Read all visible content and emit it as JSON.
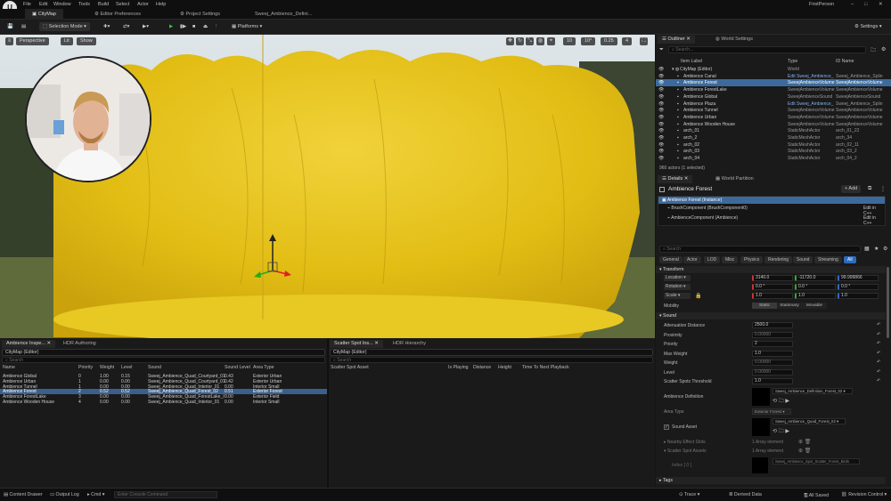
{
  "menu": [
    "File",
    "Edit",
    "Window",
    "Tools",
    "Build",
    "Select",
    "Actor",
    "Help"
  ],
  "project_name": "FirstPerson",
  "tabs": [
    "CityMap",
    "Editor Preferences",
    "Project Settings",
    "Sweej_Ambience_Defini..."
  ],
  "toolbar": {
    "selection_mode": "Selection Mode",
    "platforms": "Platforms",
    "settings": "Settings"
  },
  "viewport": {
    "perspective": "Perspective",
    "lit": "Lit",
    "show": "Show",
    "snap_values": [
      "10",
      "10°",
      "0.25",
      "4"
    ]
  },
  "bottom_left": {
    "tabs": [
      "Ambience Inspe...",
      "HDR Authoring"
    ],
    "world_dropdown": "CityMap (Editor)",
    "search_placeholder": "Search",
    "columns": [
      "Name",
      "Priority",
      "Weight",
      "Level",
      "Sound",
      "Sound Level",
      "Area Type"
    ],
    "rows": [
      [
        "Ambience Global",
        "0",
        "1.00",
        "0.15",
        "Sweej_Ambience_Quad_Courtyard_01",
        "0.43",
        "Exterior Urban"
      ],
      [
        "Ambience Urban",
        "1",
        "0.00",
        "0.00",
        "Sweej_Ambience_Quad_Courtyard_01",
        "0.42",
        "Exterior Urban"
      ],
      [
        "Ambience Tunnel",
        "1",
        "0.00",
        "0.00",
        "Sweej_Ambience_Quad_Interior_01",
        "0.00",
        "Interior Small"
      ],
      [
        "Ambience Forest",
        "2",
        "0.52",
        "0.52",
        "Sweej_Ambience_Quad_Forest_02",
        "0.51",
        "Exterior Forest"
      ],
      [
        "Ambience ForestLake",
        "3",
        "0.00",
        "0.00",
        "Sweej_Ambience_Quad_ForestLake_I",
        "0.00",
        "Exterior Field"
      ],
      [
        "Ambience Wooden House",
        "4",
        "0.00",
        "0.00",
        "Sweej_Ambience_Quad_Interior_01",
        "0.00",
        "Interior Small"
      ]
    ],
    "selected_row": 3
  },
  "bottom_right": {
    "tabs": [
      "Scatter Spot Ins...",
      "HDR Hierarchy"
    ],
    "world_dropdown": "CityMap (Editor)",
    "search_placeholder": "Search",
    "columns": [
      "Scatter Spot Asset",
      "Is Playing",
      "Distance",
      "Height",
      "Time To Next Playback"
    ]
  },
  "outliner": {
    "tabs": [
      "Outliner",
      "World Settings"
    ],
    "search_placeholder": "Search...",
    "columns": [
      "Item Label",
      "Type",
      "ID Name"
    ],
    "rows": [
      [
        "CityMap (Editor)",
        "World",
        ""
      ],
      [
        "Ambience Canal",
        "Edit Sweej_Ambience_",
        "Sweej_Ambience_Splin"
      ],
      [
        "Ambience Forest",
        "SweejAmbienceVolume",
        "SweejAmbienceVolume"
      ],
      [
        "Ambience ForestLake",
        "SweejAmbienceVolume",
        "SweejAmbienceVolume"
      ],
      [
        "Ambience Global",
        "SweejAmbienceSound",
        "SweejAmbienceSound"
      ],
      [
        "Ambience Plaza",
        "Edit Sweej_Ambience_",
        "Sweej_Ambience_Splin"
      ],
      [
        "Ambience Tunnel",
        "SweejAmbienceVolume",
        "SweejAmbienceVolume"
      ],
      [
        "Ambience Urban",
        "SweejAmbienceVolume",
        "SweejAmbienceVolume"
      ],
      [
        "Ambience Wooden House",
        "SweejAmbienceVolume",
        "SweejAmbienceVolume"
      ],
      [
        "arch_01",
        "StaticMeshActor",
        "arch_01_22"
      ],
      [
        "arch_2",
        "StaticMeshActor",
        "arch_34"
      ],
      [
        "arch_02",
        "StaticMeshActor",
        "arch_02_11"
      ],
      [
        "arch_03",
        "StaticMeshActor",
        "arch_03_2"
      ],
      [
        "arch_04",
        "StaticMeshActor",
        "arch_04_2"
      ]
    ],
    "selected_row": 2,
    "footer": "960 actors (1 selected)"
  },
  "details": {
    "tabs": [
      "Details",
      "World Partition"
    ],
    "title": "Ambience Forest",
    "add_label": "+ Add",
    "instance_label": "Ambience Forest (Instance)",
    "components": [
      {
        "name": "BrushComponent (BrushComponent0)",
        "action": "Edit in C++"
      },
      {
        "name": "AmbienceComponent (Ambience)",
        "action": "Edit in C++"
      }
    ],
    "search_placeholder": "Search",
    "filter_tabs": [
      "General",
      "Actor",
      "LOD",
      "Misc",
      "Physics",
      "Rendering",
      "Sound",
      "Streaming",
      "All"
    ],
    "transform_header": "Transform",
    "location": {
      "label": "Location",
      "x": "3140.0",
      "y": "-11720.0",
      "z": "99.999866"
    },
    "rotation": {
      "label": "Rotation",
      "x": "0.0 °",
      "y": "0.0 °",
      "z": "0.0 °"
    },
    "scale": {
      "label": "Scale",
      "x": "1.0",
      "y": "1.0",
      "z": "1.0"
    },
    "mobility": {
      "label": "Mobility",
      "options": [
        "Static",
        "Stationary",
        "Movable"
      ]
    },
    "sound_header": "Sound",
    "sound_props": [
      {
        "label": "Attenuation Distance",
        "value": "2500.0"
      },
      {
        "label": "Proximity",
        "value": "0.00000"
      },
      {
        "label": "Priority",
        "value": "2"
      },
      {
        "label": "Max Weight",
        "value": "1.0"
      },
      {
        "label": "Weight",
        "value": "0.00000"
      },
      {
        "label": "Level",
        "value": "0.00000"
      },
      {
        "label": "Scatter Spots Threshold",
        "value": "1.0"
      }
    ],
    "ambience_definition": {
      "label": "Ambience Definition",
      "value": "Sweej_Ambience_Definition_Forest_02"
    },
    "area_type": {
      "label": "Area Type",
      "value": "Exterior Forest"
    },
    "sound_asset": {
      "label": "Sound Asset",
      "value": "Sweej_Ambience_Quad_Forest_02"
    },
    "nearby_effect": {
      "label": "Nearby Effect Slots",
      "value": "1 Array element"
    },
    "scatter_spot_assets": {
      "label": "Scatter Spot Assets",
      "value": "1 Array element"
    },
    "scatter_entry": "Sweej_Ambience_Spot_Scatter_Forest_Birds",
    "tags_header": "Tags"
  },
  "statusbar": {
    "content_drawer": "Content Drawer",
    "output_log": "Output Log",
    "cmd": "Cmd",
    "console_placeholder": "Enter Console Command",
    "trace": "Trace",
    "derived_data": "Derived Data",
    "all_saved": "All Saved",
    "revision_control": "Revision Control"
  },
  "colors": {
    "accent": "#2d6cc0",
    "selection": "#3d6a9b",
    "foliage": "#e6c21a",
    "panel": "#1a1a1a"
  }
}
